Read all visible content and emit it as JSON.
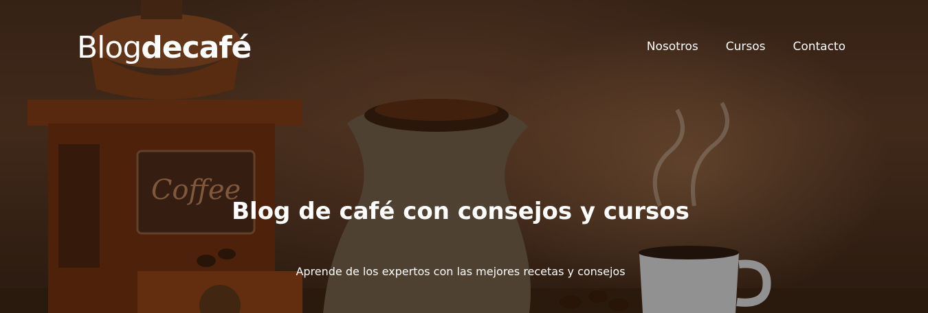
{
  "header": {
    "logo_light": "Blog",
    "logo_bold": "decafé",
    "nav": [
      {
        "label": "Nosotros"
      },
      {
        "label": "Cursos"
      },
      {
        "label": "Contacto"
      }
    ]
  },
  "hero": {
    "title": "Blog de café con consejos y cursos",
    "subtitle": "Aprende de los expertos con las mejores recetas y consejos"
  }
}
